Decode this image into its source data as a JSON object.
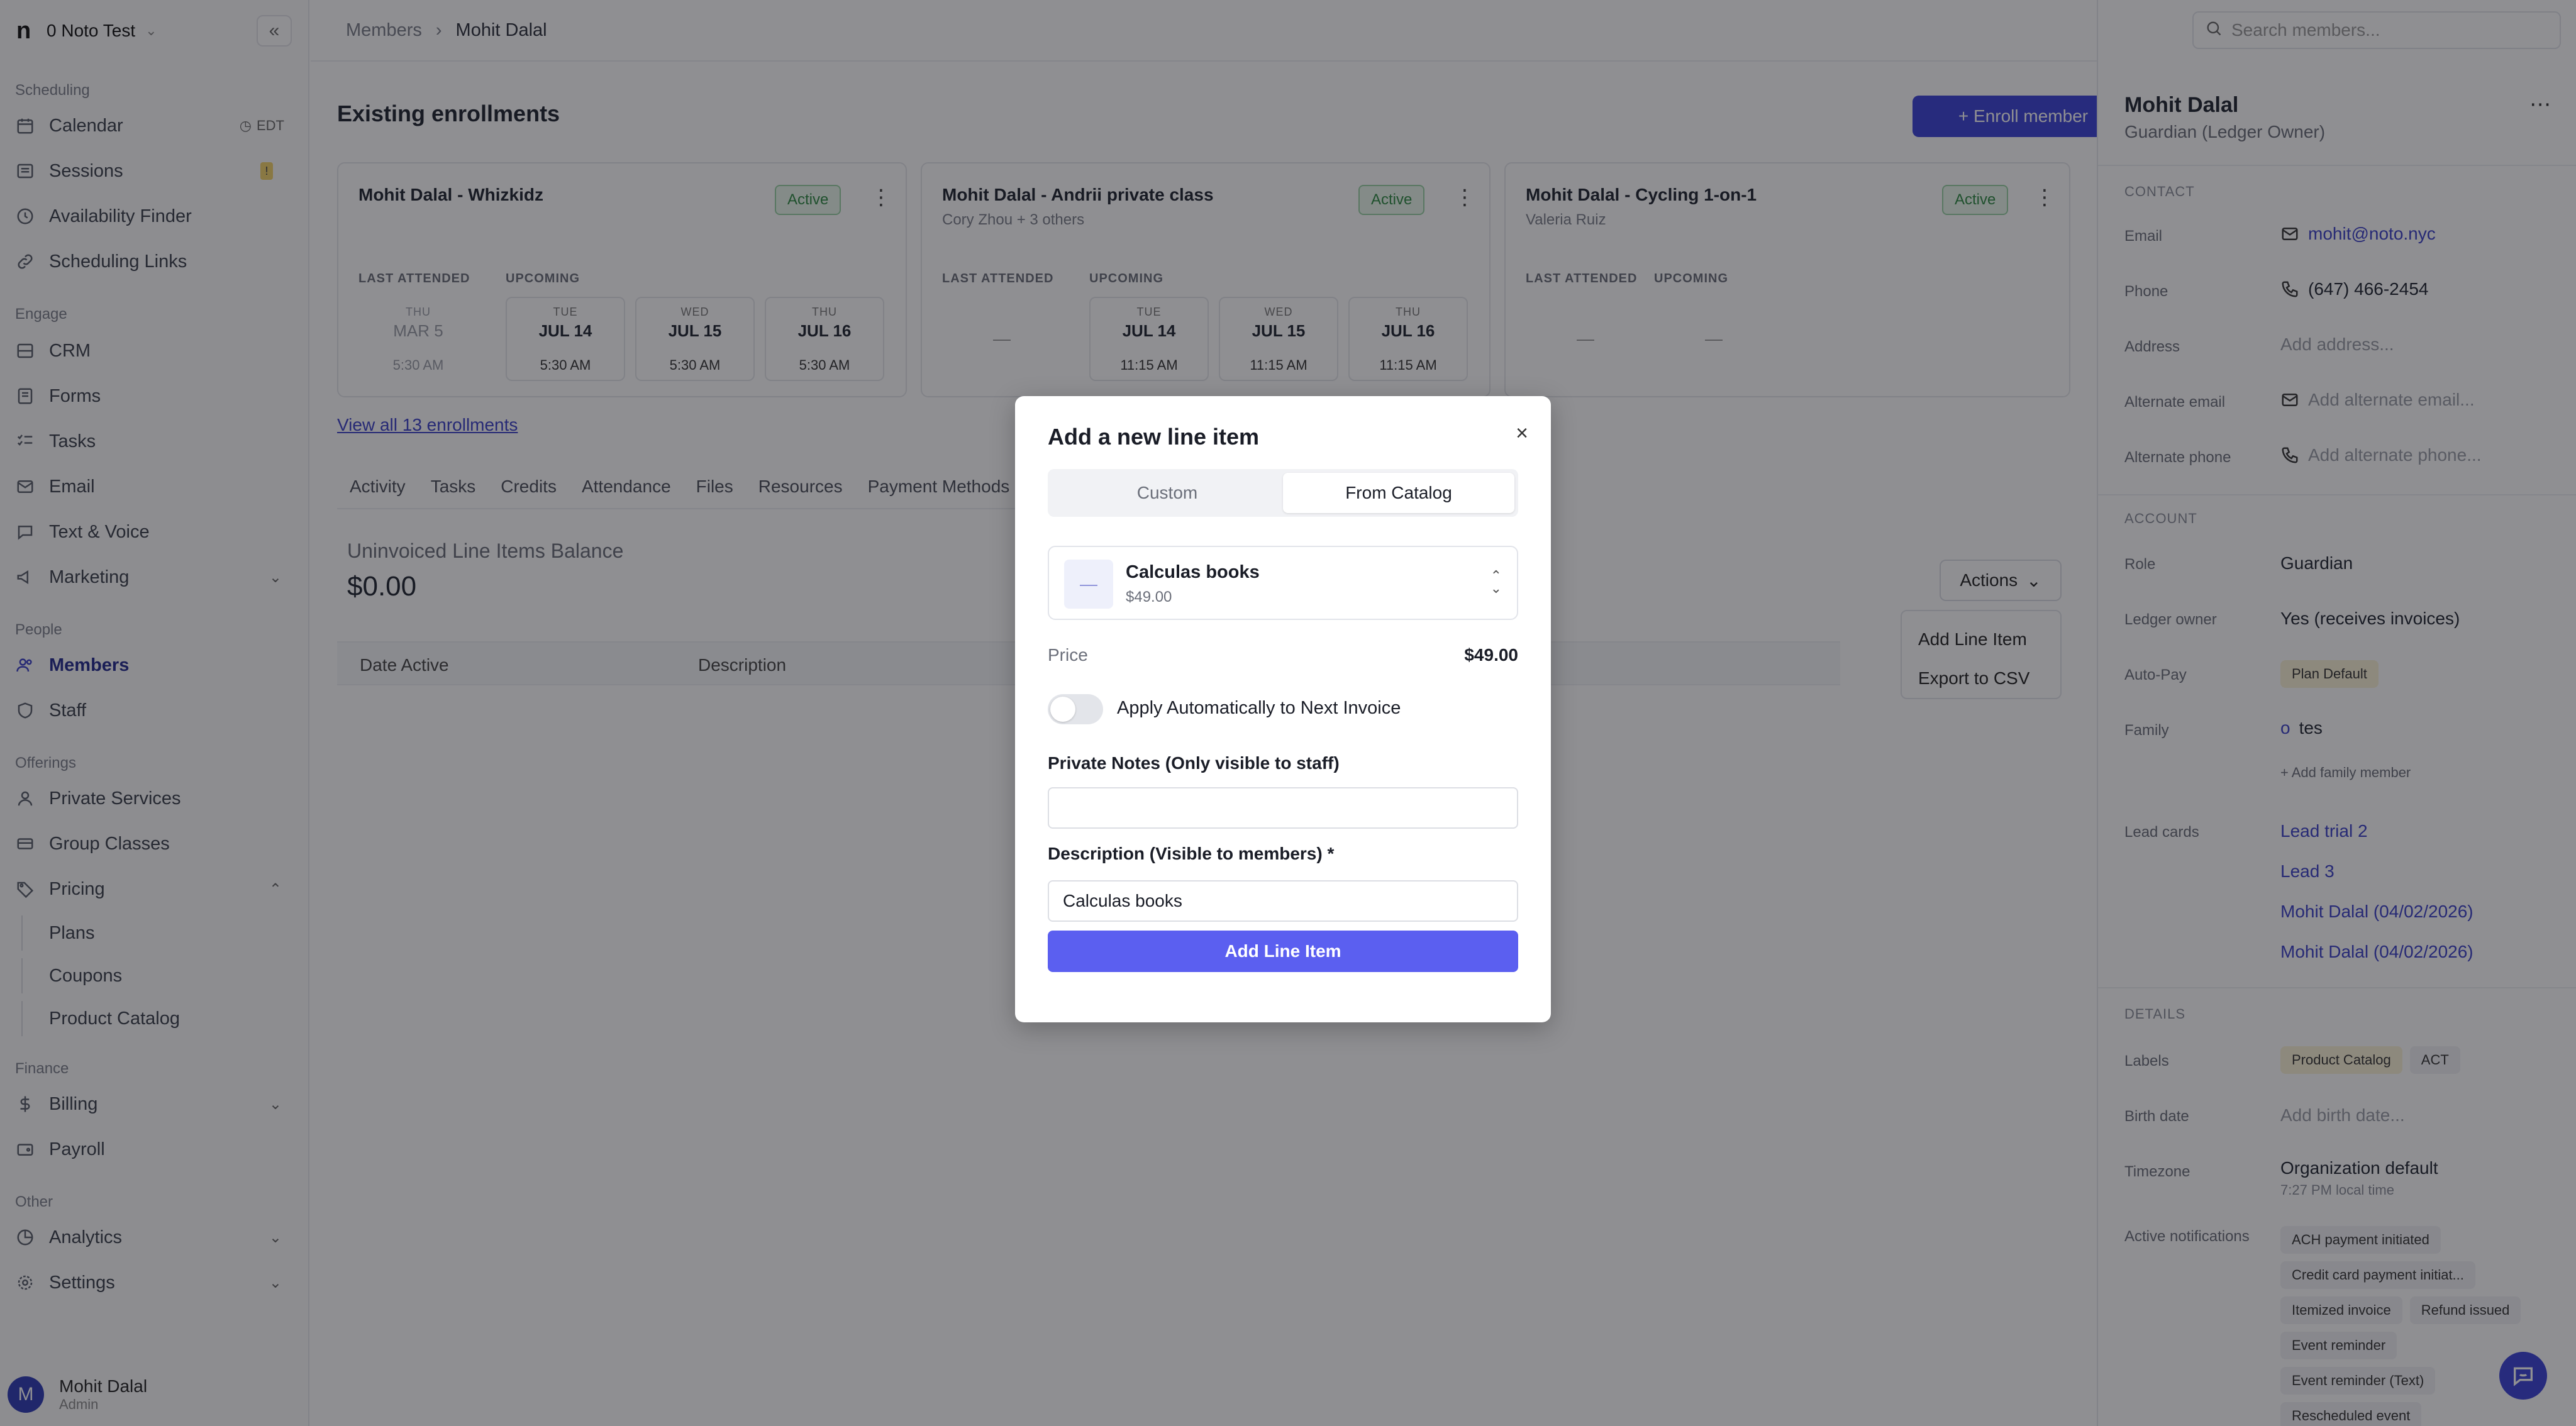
{
  "sidebar": {
    "logo": "n",
    "org_name": "0 Noto Test",
    "collapse_icon": "«",
    "sections": {
      "scheduling": "Scheduling",
      "engage": "Engage",
      "people": "People",
      "offerings": "Offerings",
      "finance": "Finance",
      "other": "Other"
    },
    "items": {
      "calendar": "Calendar",
      "calendar_tz": "EDT",
      "sessions": "Sessions",
      "sessions_badge": "!",
      "availability": "Availability Finder",
      "scheduling_links": "Scheduling Links",
      "crm": "CRM",
      "forms": "Forms",
      "tasks": "Tasks",
      "email": "Email",
      "text_voice": "Text & Voice",
      "marketing": "Marketing",
      "members": "Members",
      "staff": "Staff",
      "private_services": "Private Services",
      "group_classes": "Group Classes",
      "pricing": "Pricing",
      "plans": "Plans",
      "coupons": "Coupons",
      "product_catalog": "Product Catalog",
      "billing": "Billing",
      "payroll": "Payroll",
      "analytics": "Analytics",
      "settings": "Settings"
    },
    "user": {
      "initial": "M",
      "name": "Mohit Dalal",
      "role": "Admin"
    }
  },
  "breadcrumb": {
    "parent": "Members",
    "current": "Mohit Dalal",
    "separator": "›"
  },
  "main": {
    "title": "Existing enrollments",
    "enroll_button": "+ Enroll member",
    "view_all": "View all 13 enrollments",
    "tabs": [
      "Activity",
      "Tasks",
      "Credits",
      "Attendance",
      "Files",
      "Resources",
      "Payment Methods"
    ],
    "section_title": "Uninvoiced Line Items Balance",
    "balance": "$0.00",
    "actions_button": "Actions",
    "actions_menu": [
      "Add Line Item",
      "Export to CSV"
    ],
    "table_headers": [
      "Date Active",
      "Description"
    ]
  },
  "enrollments": [
    {
      "title": "Mohit Dalal - Whizkidz",
      "subtitle": "",
      "status": "Active",
      "last_label": "LAST ATTENDED",
      "upcoming_label": "UPCOMING",
      "last": {
        "dow": "THU",
        "date": "MAR 5",
        "time": "5:30 AM"
      },
      "upcoming": [
        {
          "dow": "TUE",
          "date": "JUL 14",
          "time": "5:30 AM"
        },
        {
          "dow": "WED",
          "date": "JUL 15",
          "time": "5:30 AM"
        },
        {
          "dow": "THU",
          "date": "JUL 16",
          "time": "5:30 AM"
        }
      ]
    },
    {
      "title": "Mohit Dalal - Andrii private class",
      "subtitle": "Cory Zhou + 3 others",
      "status": "Active",
      "last_label": "LAST ATTENDED",
      "upcoming_label": "UPCOMING",
      "last_empty": "—",
      "upcoming": [
        {
          "dow": "TUE",
          "date": "JUL 14",
          "time": "11:15 AM"
        },
        {
          "dow": "WED",
          "date": "JUL 15",
          "time": "11:15 AM"
        },
        {
          "dow": "THU",
          "date": "JUL 16",
          "time": "11:15 AM"
        }
      ]
    },
    {
      "title": "Mohit Dalal - Cycling 1-on-1",
      "subtitle": "Valeria Ruiz",
      "status": "Active",
      "last_label": "LAST ATTENDED",
      "upcoming_label": "UPCOMING",
      "last_empty": "—",
      "upcoming_empty": "—"
    }
  ],
  "right_panel": {
    "search_placeholder": "Search members...",
    "name": "Mohit Dalal",
    "role": "Guardian (Ledger Owner)",
    "contact_section": "CONTACT",
    "email_label": "Email",
    "email": "mohit@noto.nyc",
    "phone_label": "Phone",
    "phone": "(647) 466-2454",
    "address_label": "Address",
    "address": "Add address...",
    "alt_email_label": "Alternate email",
    "alt_email": "Add alternate email...",
    "alt_phone_label": "Alternate phone",
    "alt_phone": "Add alternate phone...",
    "account_section": "ACCOUNT",
    "role_label": "Role",
    "role_value": "Guardian",
    "ledger_label": "Ledger owner",
    "ledger_value": "Yes (receives invoices)",
    "autopay_label": "Auto-Pay",
    "autopay_value": "Plan Default",
    "family_label": "Family",
    "family_initial": "o",
    "family_value": "tes",
    "add_family": "+ Add family member",
    "lead_label": "Lead cards",
    "leads": [
      "Lead trial 2",
      "Lead 3",
      "Mohit Dalal (04/02/2026)",
      "Mohit Dalal (04/02/2026)"
    ],
    "details_section": "DETAILS",
    "labels_label": "Labels",
    "labels": [
      "Product Catalog",
      "ACT"
    ],
    "birth_label": "Birth date",
    "birth_value": "Add birth date...",
    "tz_label": "Timezone",
    "tz_value": "Organization default",
    "tz_sub": "7:27 PM local time",
    "notif_label": "Active notifications",
    "notifications": [
      "ACH payment initiated",
      "Credit card payment initiat...",
      "Itemized invoice",
      "Refund issued",
      "Event reminder",
      "Event reminder (Text)",
      "Rescheduled event"
    ]
  },
  "modal": {
    "title": "Add a new line item",
    "close": "×",
    "tab_custom": "Custom",
    "tab_catalog": "From Catalog",
    "selected_thumb": "—",
    "selected_name": "Calculas books",
    "selected_price": "$49.00",
    "price_label": "Price",
    "price_value": "$49.00",
    "toggle_label": "Apply Automatically to Next Invoice",
    "toggle_on": false,
    "notes_label": "Private Notes (Only visible to staff)",
    "notes_value": "",
    "desc_label": "Description (Visible to members) *",
    "desc_value": "Calculas books",
    "submit": "Add Line Item"
  },
  "colors": {
    "accent": "#3c43d8",
    "primary_button": "#5b5ff0",
    "active_badge": "#2f8a43",
    "overlay": "rgba(16,18,24,0.47)"
  }
}
